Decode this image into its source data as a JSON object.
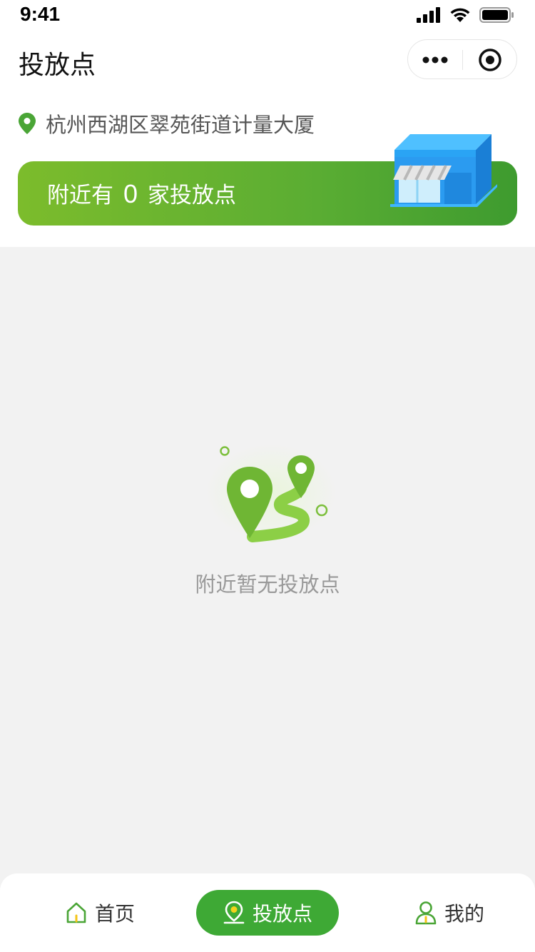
{
  "status_bar": {
    "time": "9:41"
  },
  "nav": {
    "title": "投放点",
    "more_icon": "more-dots-icon",
    "close_icon": "target-close-icon"
  },
  "location": {
    "address": "杭州西湖区翠苑街道计量大厦",
    "icon": "location-pin-icon"
  },
  "banner": {
    "prefix": "附近有",
    "count": "0",
    "suffix": "家投放点"
  },
  "empty_state": {
    "message": "附近暂无投放点"
  },
  "tabs": [
    {
      "label": "首页",
      "icon": "home-icon",
      "active": false
    },
    {
      "label": "投放点",
      "icon": "map-pin-icon",
      "active": true
    },
    {
      "label": "我的",
      "icon": "user-icon",
      "active": false
    }
  ],
  "colors": {
    "primary_green": "#3ea935",
    "banner_start": "#7cbc2c",
    "banner_end": "#3e9b2f"
  }
}
